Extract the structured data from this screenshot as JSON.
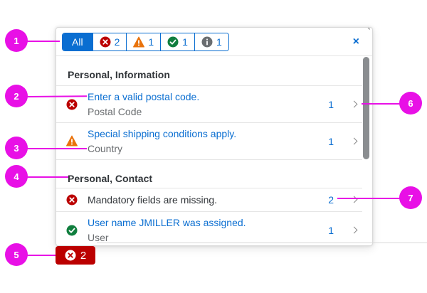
{
  "filter_bar": {
    "all_label": "All",
    "error_count": "2",
    "warning_count": "1",
    "success_count": "1",
    "info_count": "1",
    "close_label": "×"
  },
  "groups": [
    {
      "title": "Personal, Information"
    },
    {
      "title": "Personal, Contact"
    }
  ],
  "messages": [
    {
      "type": "error",
      "title": "Enter a valid postal code.",
      "subtitle": "Postal Code",
      "count": "1"
    },
    {
      "type": "warning",
      "title": "Special shipping conditions apply.",
      "subtitle": "Country",
      "count": "1"
    },
    {
      "type": "error",
      "title": "Mandatory fields are missing.",
      "subtitle": "",
      "count": "2"
    },
    {
      "type": "success",
      "title": "User name JMILLER was assigned.",
      "subtitle": "User",
      "count": "1"
    }
  ],
  "callouts": [
    "1",
    "2",
    "3",
    "4",
    "5",
    "6",
    "7"
  ],
  "message_button": {
    "count": "2"
  },
  "colors": {
    "error": "#bb0000",
    "warning": "#e9730c",
    "success": "#107e3e",
    "info": "#6a6d70",
    "accent": "#0a6ed1",
    "callout": "#e810e6"
  }
}
